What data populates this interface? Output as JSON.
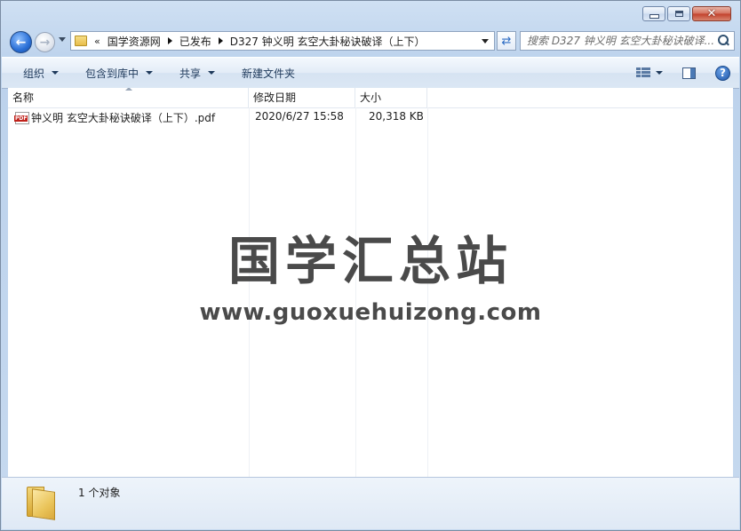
{
  "window": {
    "buttons": {
      "minimize": "minimize",
      "maximize": "maximize",
      "close": "close"
    }
  },
  "nav": {
    "back_icon": "back-arrow-icon",
    "forward_icon": "forward-arrow-icon",
    "overflow": "«",
    "breadcrumbs": [
      "国学资源网",
      "已发布",
      "D327 钟义明 玄空大卦秘诀破译（上下）"
    ],
    "search_placeholder": "搜索 D327 钟义明 玄空大卦秘诀破译..."
  },
  "toolbar": {
    "organize": "组织",
    "include_in_library": "包含到库中",
    "share": "共享",
    "new_folder": "新建文件夹"
  },
  "columns": {
    "name": "名称",
    "date": "修改日期",
    "size": "大小"
  },
  "files": [
    {
      "name": "钟义明 玄空大卦秘诀破译（上下）.pdf",
      "date": "2020/6/27 15:58",
      "size": "20,318 KB",
      "icon": "pdf-icon",
      "badge": "PDF"
    }
  ],
  "watermark": {
    "title": "国学汇总站",
    "url": "www.guoxuehuizong.com"
  },
  "status": {
    "count": "1 个对象"
  }
}
